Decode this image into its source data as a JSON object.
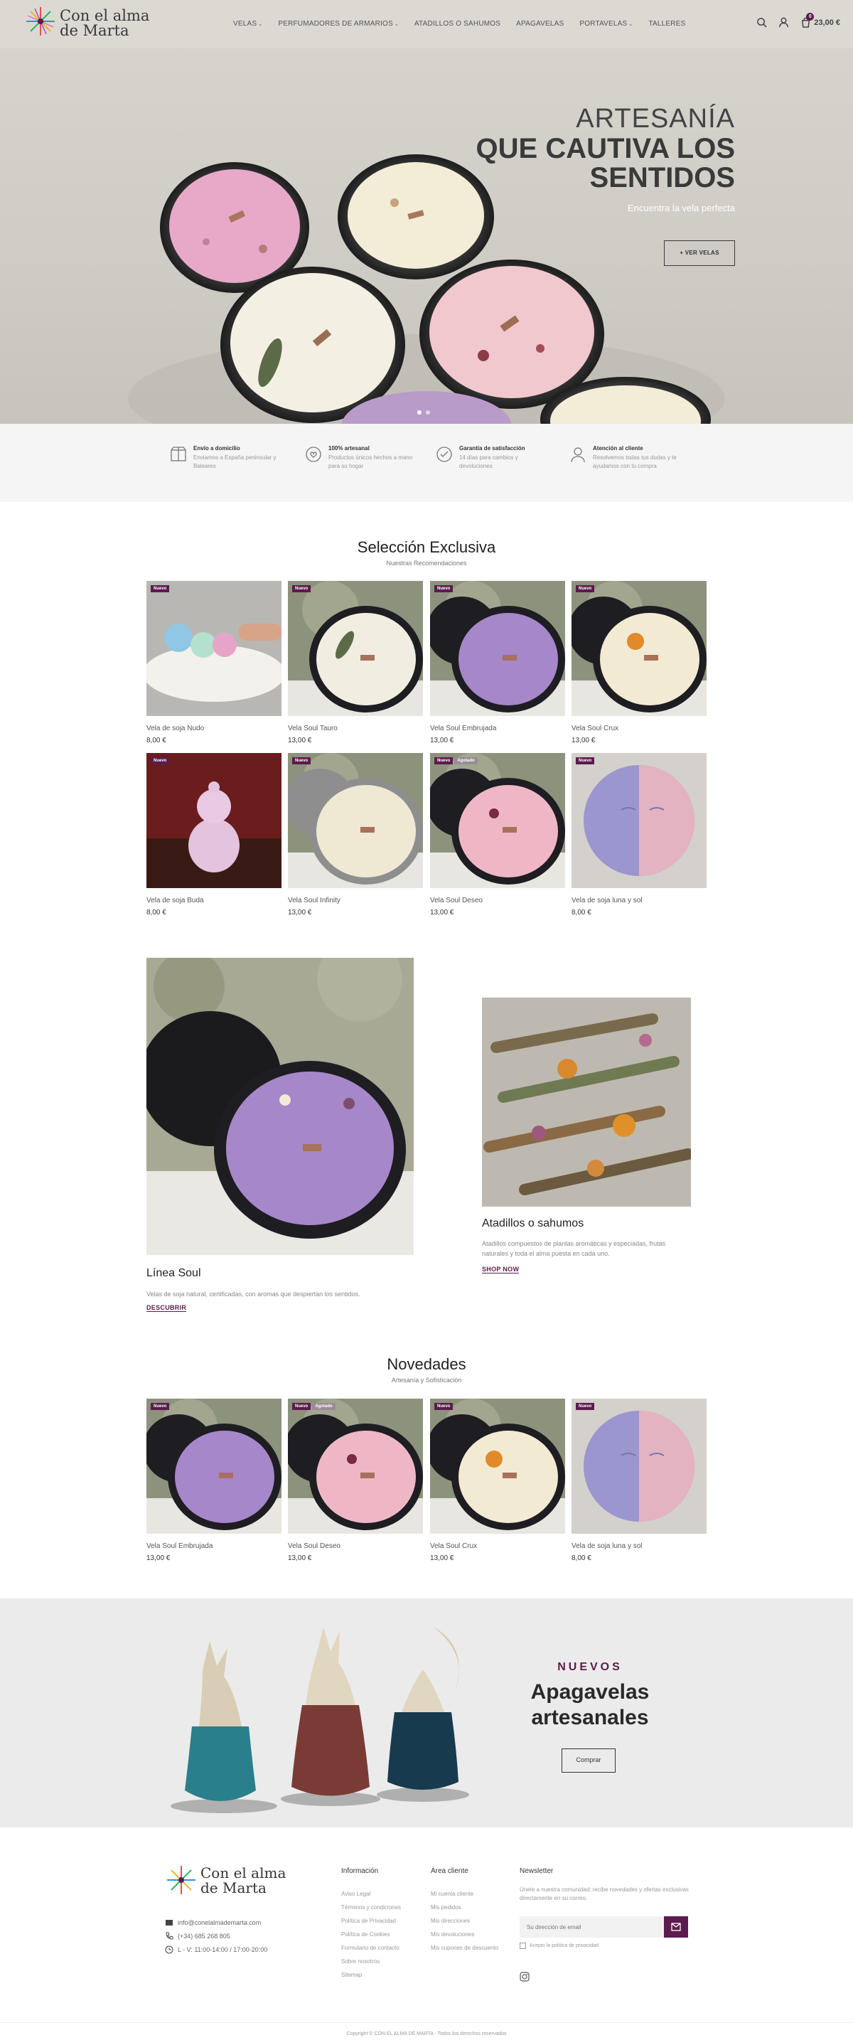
{
  "brand": {
    "name_line1": "Con el alma",
    "name_line2": "de Marta"
  },
  "nav": [
    {
      "label": "VELAS",
      "dropdown": true
    },
    {
      "label": "PERFUMADORES DE ARMARIOS",
      "dropdown": true
    },
    {
      "label": "ATADILLOS O SAHUMOS",
      "dropdown": false
    },
    {
      "label": "APAGAVELAS",
      "dropdown": false
    },
    {
      "label": "PORTAVELAS",
      "dropdown": true
    },
    {
      "label": "TALLERES",
      "dropdown": false
    }
  ],
  "header_icons": [
    "search-icon",
    "user-icon",
    "cart-icon"
  ],
  "cart": {
    "count": "0",
    "total": "23,00 €"
  },
  "hero": {
    "line1": "ARTESANÍA",
    "line2": "QUE CAUTIVA LOS",
    "line3": "SENTIDOS",
    "subtitle": "Encuentra la vela perfecta",
    "button": "+ VER VELAS"
  },
  "features": [
    {
      "icon": "box-icon",
      "title": "Envío a domicilio",
      "desc": "Enviamos a España peninsular y Baleares"
    },
    {
      "icon": "hand-heart-icon",
      "title": "100% artesanal",
      "desc": "Productos únicos hechos a mano para su hogar"
    },
    {
      "icon": "badge-check-icon",
      "title": "Garantía de satisfacción",
      "desc": "14 días para cambios y devoluciones"
    },
    {
      "icon": "support-icon",
      "title": "Atención al cliente",
      "desc": "Resolvemos todas tus dudas y te ayudamos con tu compra"
    }
  ],
  "seleccion": {
    "title": "Selección Exclusiva",
    "subtitle": "Nuestras Recomendaciones"
  },
  "products": [
    {
      "name": "Vela de soja Nudo",
      "price": "8,00 €",
      "badges": [
        "Nuevo"
      ],
      "img": "nudo"
    },
    {
      "name": "Vela Soul Tauro",
      "price": "13,00 €",
      "badges": [
        "Nuevo"
      ],
      "img": "white"
    },
    {
      "name": "Vela Soul Embrujada",
      "price": "13,00 €",
      "badges": [
        "Nuevo"
      ],
      "img": "purple"
    },
    {
      "name": "Vela Soul Crux",
      "price": "13,00 €",
      "badges": [
        "Nuevo"
      ],
      "img": "crux"
    },
    {
      "name": "Vela de soja Buda",
      "price": "8,00 €",
      "badges": [
        "Nuevo"
      ],
      "img": "buda"
    },
    {
      "name": "Vela Soul Infinity",
      "price": "13,00 €",
      "badges": [
        "Nuevo"
      ],
      "img": "infinity"
    },
    {
      "name": "Vela Soul Deseo",
      "price": "13,00 €",
      "badges": [
        "Nuevo",
        "Agotado"
      ],
      "img": "pink"
    },
    {
      "name": "Vela de soja luna y sol",
      "price": "8,00 €",
      "badges": [
        "Nuevo"
      ],
      "img": "luna"
    }
  ],
  "promo": {
    "soul_title": "Línea Soul",
    "soul_desc": "Velas de soja natural, certificadas, con aromas que despiertan los sentidos.",
    "soul_link": "DESCUBRIR",
    "atadillos_title": "Atadillos o sahumos",
    "atadillos_desc": "Atadillos compuestos de plantas aromáticas y especiadas, frutas naturales y toda el alma puesta en cada uno.",
    "atadillos_link": "SHOP NOW"
  },
  "novedades": {
    "title": "Novedades",
    "subtitle": "Artesanía y Sofisticación"
  },
  "new_products": [
    {
      "name": "Vela Soul Embrujada",
      "price": "13,00 €",
      "badges": [
        "Nuevo"
      ],
      "img": "purple"
    },
    {
      "name": "Vela Soul Deseo",
      "price": "13,00 €",
      "badges": [
        "Nuevo",
        "Agotado"
      ],
      "img": "pink"
    },
    {
      "name": "Vela Soul Crux",
      "price": "13,00 €",
      "badges": [
        "Nuevo"
      ],
      "img": "crux"
    },
    {
      "name": "Vela de soja luna y sol",
      "price": "8,00 €",
      "badges": [
        "Nuevo"
      ],
      "img": "luna"
    }
  ],
  "apagavelas": {
    "label": "NUEVOS",
    "title_line1": "Apagavelas",
    "title_line2": "artesanales",
    "button": "Comprar"
  },
  "footer": {
    "contact": [
      {
        "icon": "mail-icon",
        "text": "info@conelalmademarta.com"
      },
      {
        "icon": "phone-icon",
        "text": "(+34) 685 268 805"
      },
      {
        "icon": "clock-icon",
        "text": "L - V: 11:00-14:00 / 17:00-20:00"
      }
    ],
    "info_title": "Información",
    "info_links": [
      "Aviso Legal",
      "Términos y condiciones",
      "Política de Privacidad",
      "Política de Cookies",
      "Formulario de contacto",
      "Sobre nosotros",
      "Sitemap"
    ],
    "client_title": "Área cliente",
    "client_links": [
      "Mi cuenta cliente",
      "Mis pedidos",
      "Mis direcciones",
      "Mis devoluciones",
      "Mis cupones de descuento"
    ],
    "newsletter_title": "Newsletter",
    "newsletter_desc": "Únete a nuestra comunidad: recibe novedades y ofertas exclusivas directamente en su correo.",
    "newsletter_placeholder": "Su dirección de email",
    "newsletter_consent": "Acepto la política de privacidad",
    "copyright": "Copyright © CON EL ALMA DE MARTA · Todos los derechos reservados"
  },
  "colors": {
    "accent": "#5b1b4c",
    "header_bg": "#dcd9d2",
    "features_bg": "#f5f5f5",
    "banner_bg": "#ebebeb"
  }
}
